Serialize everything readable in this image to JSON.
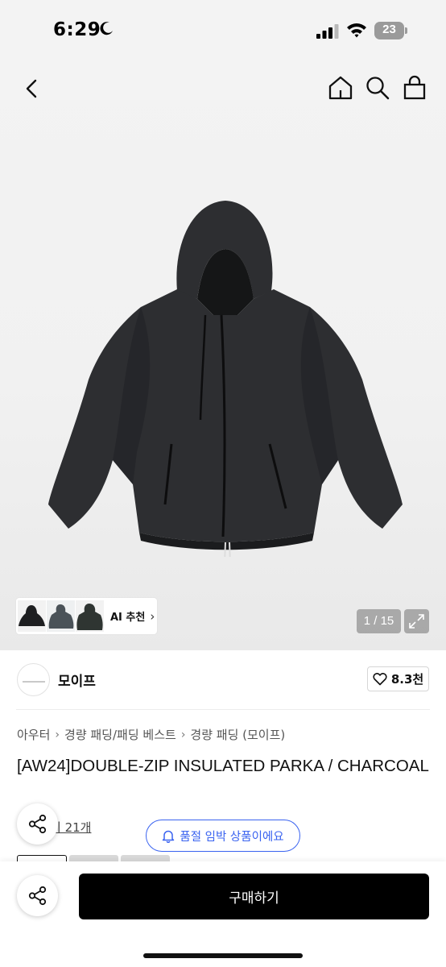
{
  "status_bar": {
    "time": "6:29",
    "battery": "23"
  },
  "gallery": {
    "ai_label": "AI 추천",
    "ai_chevron": "›",
    "counter": "1 / 15"
  },
  "brand": {
    "name": "모이프",
    "likes": "8.3천"
  },
  "breadcrumb": {
    "items": [
      "아우터",
      "경량 패딩/패딩 베스트",
      "경량 패딩 (모이프)"
    ],
    "separator": "›"
  },
  "product": {
    "title": "[AW24]DOUBLE-ZIP INSULATED PARKA / CHARCOAL",
    "review_link": "기 21개"
  },
  "notice": {
    "soldout": "품절 임박 상품이에요"
  },
  "bottom": {
    "buy_label": "구매하기"
  },
  "icons": {
    "nav": [
      "back-icon",
      "home-icon",
      "search-icon",
      "bag-icon"
    ],
    "other": [
      "moon-icon",
      "signal-icon",
      "wifi-icon",
      "heart-icon",
      "bell-icon",
      "share-icon",
      "expand-icon"
    ]
  },
  "colors": {
    "accent_blue": "#3a63f0",
    "buy_button": "#000000",
    "jacket": "#2d2e31"
  }
}
